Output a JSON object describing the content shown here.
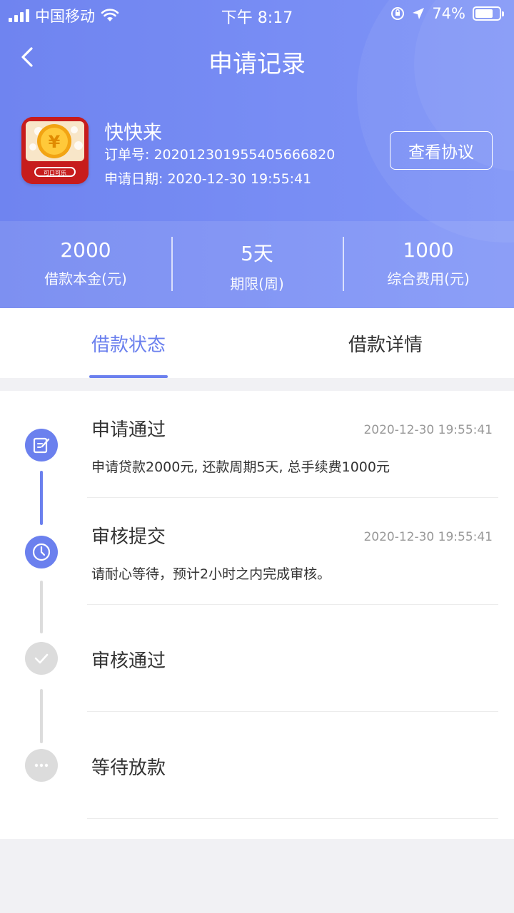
{
  "status_bar": {
    "carrier": "中国移动",
    "time": "下午 8:17",
    "battery": "74%",
    "battery_level": 0.74
  },
  "nav": {
    "title": "申请记录",
    "back_icon": "chevron-left-icon"
  },
  "app": {
    "name": "快快来",
    "order_no": "订单号: 20201230195540566682​0",
    "apply_date": "申请日期: 2020-12-30 19:55:41",
    "agreement_button": "查看协议",
    "icon_text": "可口可乐"
  },
  "stats": [
    {
      "value": "2000",
      "label": "借款本金(元)"
    },
    {
      "value": "5天",
      "label": "期限(周)"
    },
    {
      "value": "1000",
      "label": "综合费用(元)"
    }
  ],
  "tabs": [
    {
      "label": "借款状态",
      "active": true
    },
    {
      "label": "借款详情",
      "active": false
    }
  ],
  "steps": [
    {
      "title": "申请通过",
      "time": "2020-12-30 19:55:41",
      "desc": "申请贷款2000元, 还款周期5天, 总手续费1000元",
      "icon": "edit-icon",
      "active": true
    },
    {
      "title": "审核提交",
      "time": "2020-12-30 19:55:41",
      "desc": "请耐心等待，预计2小时之内完成审核。",
      "icon": "clock-icon",
      "active": true
    },
    {
      "title": "审核通过",
      "time": "",
      "desc": "",
      "icon": "check-icon",
      "active": false
    },
    {
      "title": "等待放款",
      "time": "",
      "desc": "",
      "icon": "more-icon",
      "active": false
    }
  ],
  "colors": {
    "accent": "#6b80ee",
    "header_gradient_start": "#6f84f0",
    "header_gradient_end": "#7f94f7",
    "inactive": "#dcdcdc"
  }
}
